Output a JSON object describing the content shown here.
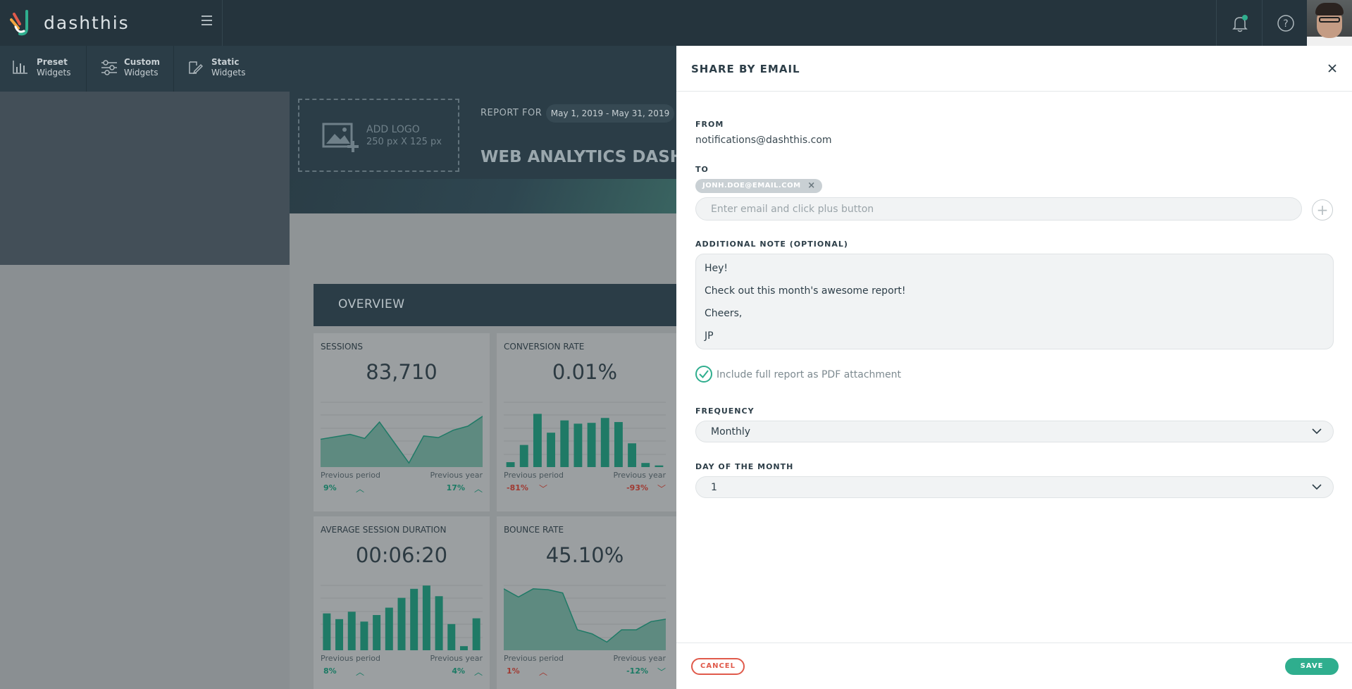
{
  "app": {
    "brand": "dashthis",
    "colors": {
      "accent": "#2fae8e",
      "danger": "#e05a4b",
      "dark": "#25343d"
    }
  },
  "widgets_bar": {
    "tabs": [
      {
        "line1": "Preset",
        "line2": "Widgets",
        "icon": "bar-chart-icon"
      },
      {
        "line1": "Custom",
        "line2": "Widgets",
        "icon": "sliders-icon"
      },
      {
        "line1": "Static",
        "line2": "Widgets",
        "icon": "edit-icon"
      }
    ]
  },
  "report": {
    "logo_label": "ADD LOGO",
    "logo_size": "250 px X 125 px",
    "report_for_label": "REPORT FOR",
    "date_range": "May 1, 2019 - May 31, 2019",
    "title": "WEB ANALYTICS DASHB"
  },
  "overview": {
    "title": "OVERVIEW",
    "cards": [
      {
        "title": "SESSIONS",
        "value": "83,710",
        "prev_period_label": "Previous period",
        "prev_year_label": "Previous year",
        "prev_period": "9%",
        "prev_year": "17%",
        "chart": "area",
        "series": [
          34,
          37,
          40,
          35,
          55,
          30,
          5,
          38,
          36,
          45,
          50,
          62
        ]
      },
      {
        "title": "CONVERSION RATE",
        "value": "0.01%",
        "prev_period_label": "Previous period",
        "prev_year_label": "Previous year",
        "prev_period": "-81%",
        "prev_year": "-93%",
        "chart": "bar",
        "series": [
          6,
          27,
          65,
          42,
          57,
          53,
          54,
          60,
          55,
          29,
          5,
          2
        ]
      },
      {
        "title": "AVERAGE SESSION DURATION",
        "value": "00:06:20",
        "prev_period_label": "Previous period",
        "prev_year_label": "Previous year",
        "prev_period": "8%",
        "prev_year": "4%",
        "chart": "bar",
        "series": [
          45,
          38,
          47,
          35,
          43,
          52,
          64,
          75,
          79,
          66,
          32,
          5,
          39
        ]
      },
      {
        "title": "BOUNCE RATE",
        "value": "45.10%",
        "prev_period_label": "Previous period",
        "prev_year_label": "Previous year",
        "prev_period": "1%",
        "prev_year": "-12%",
        "chart": "area",
        "series": [
          75,
          65,
          75,
          74,
          70,
          25,
          20,
          10,
          25,
          25,
          35,
          38
        ]
      }
    ]
  },
  "modal": {
    "title": "SHARE BY EMAIL",
    "from_label": "FROM",
    "from_value": "notifications@dashthis.com",
    "to_label": "TO",
    "recipient_tag": "JONH.DOE@EMAIL.COM",
    "email_placeholder": "Enter email and click plus button",
    "note_label": "ADDITIONAL NOTE (OPTIONAL)",
    "note_lines": [
      "Hey!",
      "Check out this month's awesome report!",
      "Cheers,",
      "JP"
    ],
    "pdf_checkbox_label": "Include full report as PDF attachment",
    "pdf_checked": true,
    "frequency_label": "FREQUENCY",
    "frequency_value": "Monthly",
    "day_label": "DAY OF THE MONTH",
    "day_value": "1",
    "cancel_label": "CANCEL",
    "save_label": "SAVE"
  }
}
